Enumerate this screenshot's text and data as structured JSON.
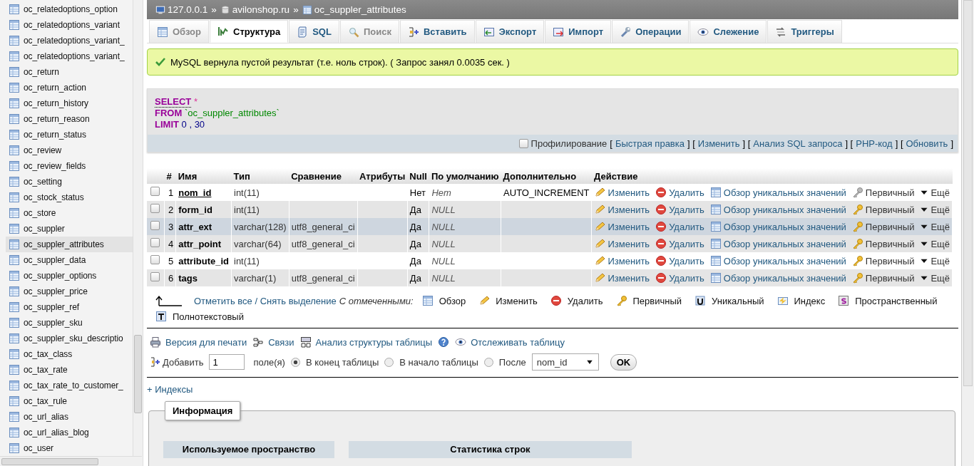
{
  "sidebar": {
    "items": [
      {
        "label": "oc_relatedoptions_option",
        "selected": false
      },
      {
        "label": "oc_relatedoptions_variant",
        "selected": false
      },
      {
        "label": "oc_relatedoptions_variant_",
        "selected": false
      },
      {
        "label": "oc_relatedoptions_variant_",
        "selected": false
      },
      {
        "label": "oc_return",
        "selected": false
      },
      {
        "label": "oc_return_action",
        "selected": false
      },
      {
        "label": "oc_return_history",
        "selected": false
      },
      {
        "label": "oc_return_reason",
        "selected": false
      },
      {
        "label": "oc_return_status",
        "selected": false
      },
      {
        "label": "oc_review",
        "selected": false
      },
      {
        "label": "oc_review_fields",
        "selected": false
      },
      {
        "label": "oc_setting",
        "selected": false
      },
      {
        "label": "oc_stock_status",
        "selected": false
      },
      {
        "label": "oc_store",
        "selected": false
      },
      {
        "label": "oc_suppler",
        "selected": false
      },
      {
        "label": "oc_suppler_attributes",
        "selected": true
      },
      {
        "label": "oc_suppler_data",
        "selected": false
      },
      {
        "label": "oc_suppler_options",
        "selected": false
      },
      {
        "label": "oc_suppler_price",
        "selected": false
      },
      {
        "label": "oc_suppler_ref",
        "selected": false
      },
      {
        "label": "oc_suppler_sku",
        "selected": false
      },
      {
        "label": "oc_suppler_sku_descriptio",
        "selected": false
      },
      {
        "label": "oc_tax_class",
        "selected": false
      },
      {
        "label": "oc_tax_rate",
        "selected": false
      },
      {
        "label": "oc_tax_rate_to_customer_",
        "selected": false
      },
      {
        "label": "oc_tax_rule",
        "selected": false
      },
      {
        "label": "oc_url_alias",
        "selected": false
      },
      {
        "label": "oc_url_alias_blog",
        "selected": false
      },
      {
        "label": "oc_user",
        "selected": false
      }
    ]
  },
  "breadcrumb": [
    {
      "label": "127.0.0.1",
      "kind": "server"
    },
    {
      "label": "»",
      "kind": "separator"
    },
    {
      "label": "avilonshop.ru",
      "kind": "database"
    },
    {
      "label": "»",
      "kind": "separator"
    },
    {
      "label": "oc_suppler_attributes",
      "kind": "table"
    }
  ],
  "tabs": [
    {
      "label": "Обзор",
      "selected": false,
      "disabled": true
    },
    {
      "label": "Структура",
      "selected": true,
      "disabled": false
    },
    {
      "label": "SQL",
      "selected": false,
      "disabled": false
    },
    {
      "label": "Поиск",
      "selected": false,
      "disabled": true
    },
    {
      "label": "Вставить",
      "selected": false,
      "disabled": false
    },
    {
      "label": "Экспорт",
      "selected": false,
      "disabled": false
    },
    {
      "label": "Импорт",
      "selected": false,
      "disabled": false
    },
    {
      "label": "Операции",
      "selected": false,
      "disabled": false
    },
    {
      "label": "Слежение",
      "selected": false,
      "disabled": false
    },
    {
      "label": "Триггеры",
      "selected": false,
      "disabled": false
    }
  ],
  "message": "MySQL вернула пустой результат (т.е. ноль строк). ( Запрос занял 0.0035 сек. )",
  "query": [
    {
      "keyword": "SELECT",
      "rest": "*"
    },
    {
      "keyword": "FROM",
      "rest": "`oc_suppler_attributes`"
    },
    {
      "keyword": "LIMIT",
      "rest": "0 , 30"
    }
  ],
  "query_options": {
    "profiling": {
      "label": "Профилирование",
      "checked": false
    },
    "links": [
      {
        "text": "[",
        "kind": "punct"
      },
      {
        "text": "Быстрая правка",
        "kind": "link"
      },
      {
        "text": "] [",
        "kind": "punct"
      },
      {
        "text": "Изменить",
        "kind": "link"
      },
      {
        "text": "] [",
        "kind": "punct"
      },
      {
        "text": "Анализ SQL запроса",
        "kind": "link"
      },
      {
        "text": "] [",
        "kind": "punct"
      },
      {
        "text": "PHP-код",
        "kind": "link"
      },
      {
        "text": "] [",
        "kind": "punct"
      },
      {
        "text": "Обновить",
        "kind": "link"
      },
      {
        "text": "]",
        "kind": "punct"
      }
    ]
  },
  "table": {
    "columns": [
      "#",
      "Имя",
      "Тип",
      "Сравнение",
      "Атрибуты",
      "Null",
      "По умолчанию",
      "Дополнительно",
      "Действие"
    ],
    "rows": [
      {
        "num": "1",
        "name": "nom_id",
        "type": "int(11)",
        "collation": "",
        "attributes": "",
        "null": "Нет",
        "default": "Нет",
        "extra": "AUTO_INCREMENT",
        "checked": false,
        "highlighted": false,
        "primary": true,
        "actions": [
          "Изменить",
          "Удалить",
          "Обзор уникальных значений",
          "Первичный",
          "Ещё"
        ]
      },
      {
        "num": "2",
        "name": "form_id",
        "type": "int(11)",
        "collation": "",
        "attributes": "",
        "null": "Да",
        "default": "NULL",
        "extra": "",
        "checked": false,
        "highlighted": false,
        "primary": false,
        "actions": [
          "Изменить",
          "Удалить",
          "Обзор уникальных значений",
          "Первичный",
          "Ещё"
        ]
      },
      {
        "num": "3",
        "name": "attr_ext",
        "type": "varchar(128)",
        "collation": "utf8_general_ci",
        "attributes": "",
        "null": "Да",
        "default": "NULL",
        "extra": "",
        "checked": false,
        "highlighted": true,
        "primary": false,
        "actions": [
          "Изменить",
          "Удалить",
          "Обзор уникальных значений",
          "Первичный",
          "Ещё"
        ]
      },
      {
        "num": "4",
        "name": "attr_point",
        "type": "varchar(64)",
        "collation": "utf8_general_ci",
        "attributes": "",
        "null": "Да",
        "default": "NULL",
        "extra": "",
        "checked": false,
        "highlighted": false,
        "primary": false,
        "actions": [
          "Изменить",
          "Удалить",
          "Обзор уникальных значений",
          "Первичный",
          "Ещё"
        ]
      },
      {
        "num": "5",
        "name": "attribute_id",
        "type": "int(11)",
        "collation": "",
        "attributes": "",
        "null": "Да",
        "default": "NULL",
        "extra": "",
        "checked": false,
        "highlighted": false,
        "primary": false,
        "actions": [
          "Изменить",
          "Удалить",
          "Обзор уникальных значений",
          "Первичный",
          "Ещё"
        ]
      },
      {
        "num": "6",
        "name": "tags",
        "type": "varchar(1)",
        "collation": "utf8_general_ci",
        "attributes": "",
        "null": "Да",
        "default": "NULL",
        "extra": "",
        "checked": false,
        "highlighted": false,
        "primary": false,
        "actions": [
          "Изменить",
          "Удалить",
          "Обзор уникальных значений",
          "Первичный",
          "Ещё"
        ]
      }
    ]
  },
  "bulk": {
    "check_all": "Отметить все / Снять выделение",
    "with_selected": "С отмеченными:",
    "actions": [
      "Обзор",
      "Изменить",
      "Удалить",
      "Первичный",
      "Уникальный",
      "Индекс",
      "Пространственный",
      "Полнотекстовый"
    ]
  },
  "tools": [
    "Версия для печати",
    "Связи",
    "Анализ структуры таблицы",
    "Отслеживать таблицу"
  ],
  "add_column": {
    "label": "Добавить",
    "value": "1",
    "unit": "поле(я)",
    "positions": [
      {
        "label": "В конец таблицы",
        "selected": true
      },
      {
        "label": "В начало таблицы",
        "selected": false
      },
      {
        "label": "После",
        "selected": false
      }
    ],
    "after": "nom_id",
    "ok": "OK"
  },
  "indexes": "+ Индексы",
  "info": {
    "legend": "Информация",
    "panels": [
      "Используемое пространство",
      "Статистика строк"
    ]
  }
}
